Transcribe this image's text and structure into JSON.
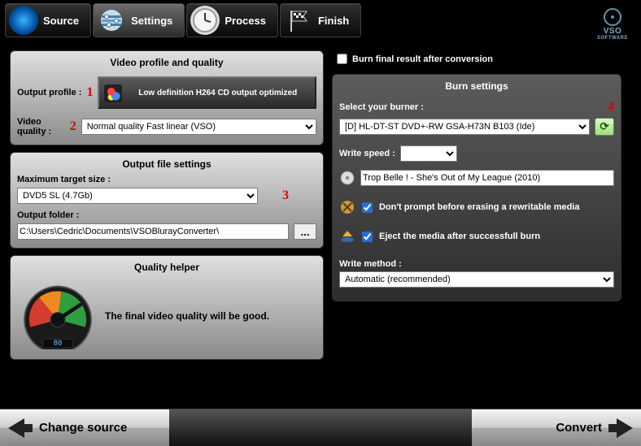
{
  "tabs": {
    "source": "Source",
    "settings": "Settings",
    "process": "Process",
    "finish": "Finish"
  },
  "logo": {
    "line1": "VSO",
    "line2": "SOFTWARE"
  },
  "annotations": {
    "n1": "1",
    "n2": "2",
    "n3": "3",
    "n4": "4"
  },
  "profile_panel": {
    "title": "Video profile and quality",
    "output_profile_label": "Output profile :",
    "output_profile_value": "Low definition H264 CD output optimized",
    "video_quality_label": "Video quality :",
    "video_quality_value": "Normal quality Fast linear (VSO)"
  },
  "output_panel": {
    "title": "Output file settings",
    "max_size_label": "Maximum target size :",
    "max_size_value": "DVD5 SL (4.7Gb)",
    "output_folder_label": "Output folder :",
    "output_folder_value": "C:\\Users\\Cedric\\Documents\\VSOBlurayConverter\\",
    "browse": "..."
  },
  "quality_panel": {
    "title": "Quality helper",
    "message": "The final video quality will be good.",
    "gauge_value": "80"
  },
  "burn": {
    "checkbox_label": "Burn final result after conversion",
    "panel_title": "Burn settings",
    "select_burner_label": "Select your burner :",
    "burner_value": "[D] HL-DT-ST DVD+-RW GSA-H73N B103 (Ide)",
    "write_speed_label": "Write speed :",
    "write_speed_value": "",
    "disc_label_value": "Trop Belle ! - She's Out of My League (2010)",
    "dont_prompt_label": "Don't prompt before erasing a rewritable media",
    "eject_label": "Eject the media after successfull burn",
    "write_method_label": "Write method :",
    "write_method_value": "Automatic (recommended)"
  },
  "bottom": {
    "left": "Change source",
    "right": "Convert"
  }
}
